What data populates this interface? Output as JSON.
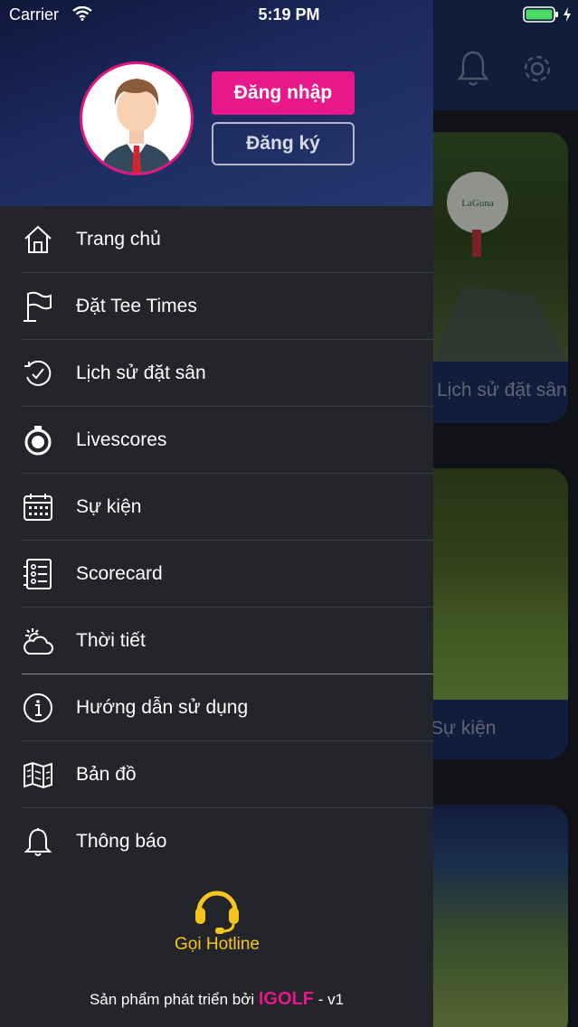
{
  "status_bar": {
    "carrier": "Carrier",
    "time": "5:19 PM"
  },
  "drawer": {
    "login_button": "Đăng nhập",
    "register_button": "Đăng ký",
    "menu": [
      {
        "label": "Trang chủ",
        "icon": "home-icon"
      },
      {
        "label": "Đặt Tee Times",
        "icon": "flag-icon"
      },
      {
        "label": "Lịch sử đặt sân",
        "icon": "history-icon"
      },
      {
        "label": "Livescores",
        "icon": "stopwatch-icon"
      },
      {
        "label": "Sự kiện",
        "icon": "calendar-icon"
      },
      {
        "label": "Scorecard",
        "icon": "scorecard-icon"
      },
      {
        "label": "Thời tiết",
        "icon": "weather-icon"
      },
      {
        "label": "Hướng dẫn sử dụng",
        "icon": "info-icon"
      },
      {
        "label": "Bản đồ",
        "icon": "map-icon"
      },
      {
        "label": "Thông báo",
        "icon": "bell-icon"
      }
    ],
    "hotline_label": "Gọi Hotline",
    "footer": {
      "prefix": "Sản phẩm phát triển bởi",
      "brand": "IGOLF",
      "suffix": "- v1"
    }
  },
  "background": {
    "cards": [
      {
        "label": "Lịch sử đặt sân"
      },
      {
        "label": "Sự kiện"
      },
      {
        "label": ""
      }
    ],
    "golf_ball_logo": "LaGuna"
  },
  "colors": {
    "accent": "#e8178a",
    "hotline": "#f7c51c",
    "drawer_bg": "#23252b",
    "header_bg": "#1c2a60"
  }
}
